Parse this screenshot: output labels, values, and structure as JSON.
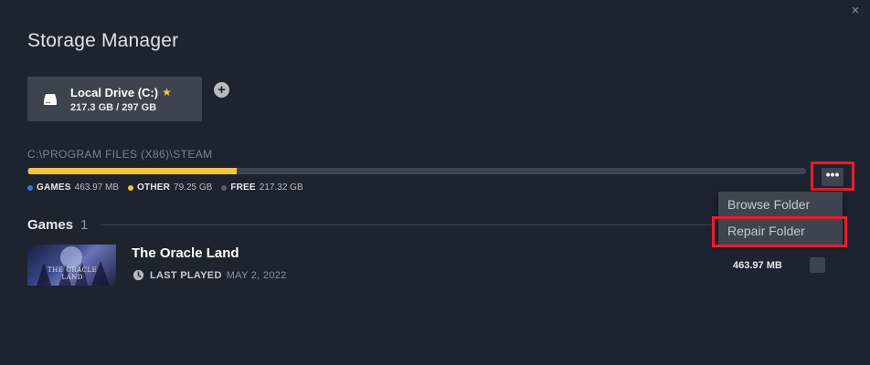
{
  "window": {
    "title": "Storage Manager",
    "close_label": "×"
  },
  "drive": {
    "name": "Local Drive (C:)",
    "size": "217.3 GB / 297 GB",
    "add_label": "+"
  },
  "storage": {
    "path": "C:\\PROGRAM FILES (X86)\\STEAM",
    "games_fraction": 0.0016,
    "other_fraction": 0.2668,
    "legend": [
      {
        "key": "GAMES",
        "value": "463.97 MB",
        "color": "#2f7bd6"
      },
      {
        "key": "OTHER",
        "value": "79.25 GB",
        "color": "#f2c53d"
      },
      {
        "key": "FREE",
        "value": "217.32 GB",
        "color": "#3d4450"
      }
    ],
    "more_label": "•••"
  },
  "menu": {
    "items": [
      "Browse Folder",
      "Repair Folder"
    ]
  },
  "games": {
    "header": "Games",
    "count": "1",
    "rows": [
      {
        "name": "The Oracle Land",
        "thumb_text": "THE ORACLE LAND",
        "last_played_label": "LAST PLAYED",
        "last_played_date": "MAY 2, 2022",
        "size": "463.97 MB"
      }
    ]
  },
  "colors": {
    "background": "#1e2330",
    "panel": "#3d4450",
    "accent_yellow": "#f2c53d",
    "accent_blue": "#2f7bd6",
    "highlight_red": "#e81d2c"
  }
}
